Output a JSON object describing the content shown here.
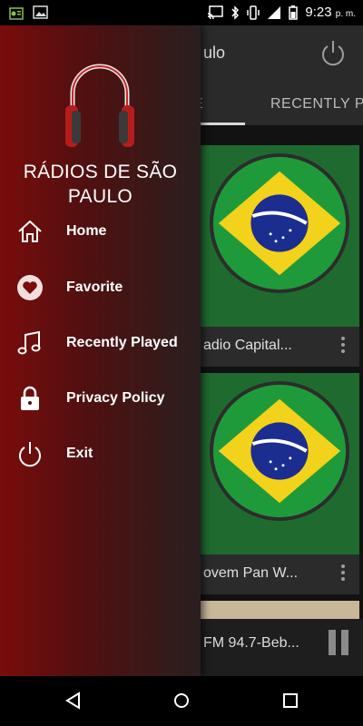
{
  "status_bar": {
    "time": "9:23",
    "ampm": "p. m.",
    "left_icons": [
      "radio-notification-icon",
      "image-notification-icon"
    ],
    "right_icons": [
      "cast-icon",
      "bluetooth-icon",
      "vibrate-icon",
      "signal-icon",
      "battery-icon"
    ]
  },
  "app": {
    "title": "ulo",
    "tabs": [
      {
        "label": "E"
      },
      {
        "label": "RECENTLY PL"
      }
    ],
    "cards": [
      {
        "label": "adio Capital..."
      },
      {
        "label": "ovem Pan W..."
      }
    ],
    "player": {
      "label": "FM 94.7-Beb..."
    }
  },
  "drawer": {
    "title": "RÁDIOS DE SÃO PAULO",
    "menu": [
      {
        "label": "Home",
        "icon": "home-icon"
      },
      {
        "label": "Favorite",
        "icon": "heart-icon"
      },
      {
        "label": "Recently Played",
        "icon": "music-note-icon"
      },
      {
        "label": "Privacy Policy",
        "icon": "lock-icon"
      },
      {
        "label": "Exit",
        "icon": "power-icon"
      }
    ]
  },
  "colors": {
    "drawer_start": "#7a0c0c",
    "drawer_end": "#2a1f1f",
    "flag_green": "#1f9a3a",
    "flag_yellow": "#f2d21b",
    "flag_blue": "#1b2d8f"
  }
}
